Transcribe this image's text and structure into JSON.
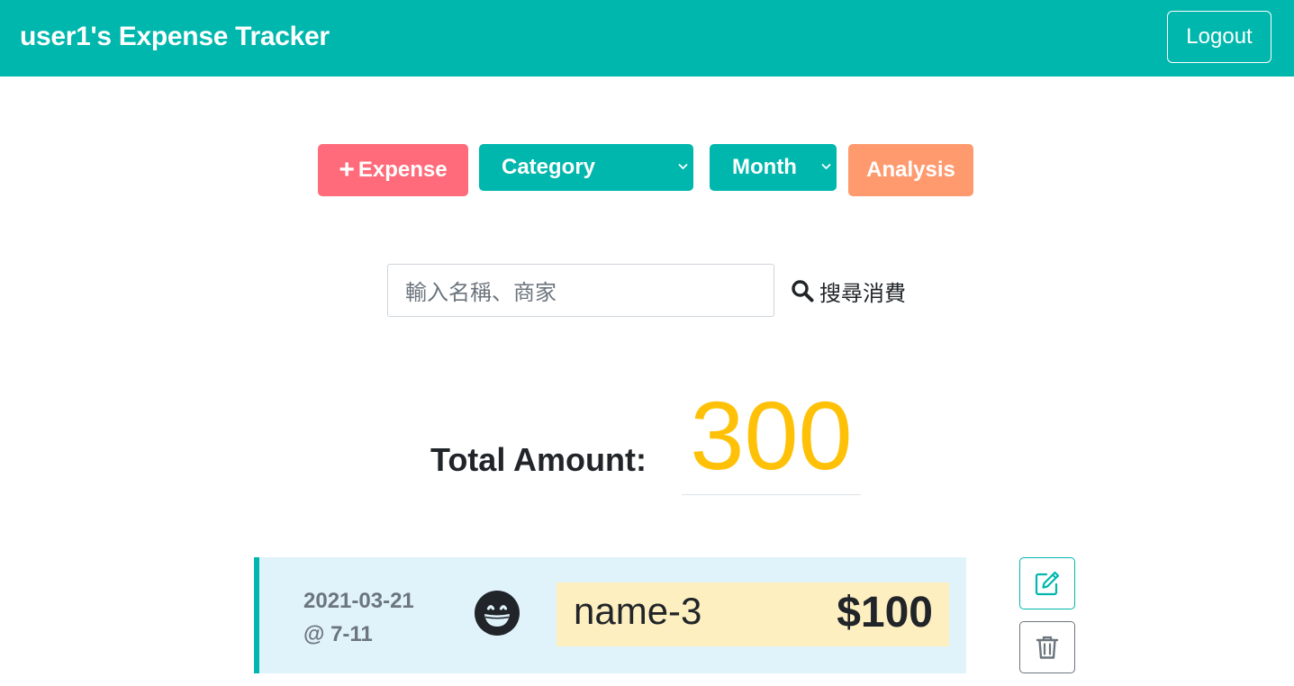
{
  "navbar": {
    "brand": "user1's Expense Tracker",
    "logout_label": "Logout"
  },
  "toolbar": {
    "add_expense_icon": "+",
    "add_expense_label": "Expense",
    "category_select": {
      "selected": "Category"
    },
    "month_select": {
      "selected": "Month"
    },
    "analysis_label": "Analysis"
  },
  "search": {
    "placeholder": "輸入名稱、商家",
    "button_label": "搜尋消費"
  },
  "summary": {
    "total_label": "Total Amount:",
    "total_value": "300"
  },
  "records": [
    {
      "date": "2021-03-21",
      "merchant": "@ 7-11",
      "icon": "grin-icon",
      "name": "name-3",
      "amount": "$100"
    }
  ],
  "colors": {
    "primary": "#00b7ad",
    "expense_button": "#ff6b7a",
    "analysis_button": "#ff9a6f",
    "total_value": "#ffc107",
    "record_bg": "#e0f3fa",
    "record_highlight": "#fdefc0"
  }
}
